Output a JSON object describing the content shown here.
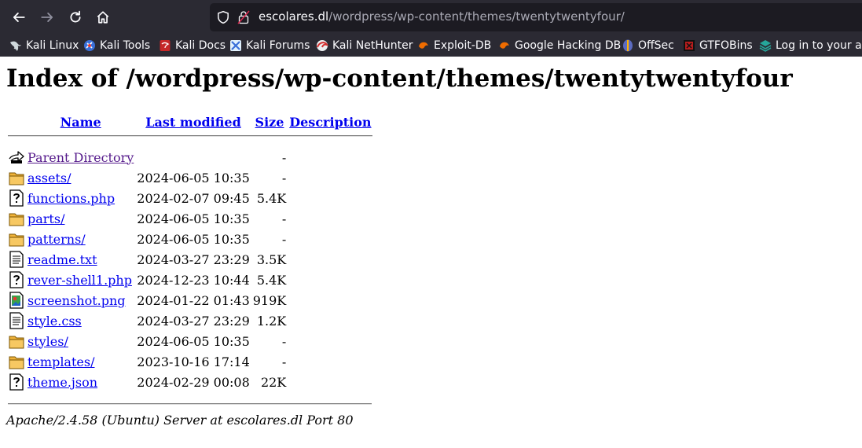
{
  "browser": {
    "url_host": "escolares.dl",
    "url_path": "/wordpress/wp-content/themes/twentytwentyfour/",
    "bookmarks": [
      {
        "label": "Kali Linux",
        "icon": "kali-dragon-icon",
        "color": "#cfd8dc"
      },
      {
        "label": "Kali Tools",
        "icon": "kali-tools-icon",
        "color": "#3a6fd8"
      },
      {
        "label": "Kali Docs",
        "icon": "kali-docs-icon",
        "color": "#c62828"
      },
      {
        "label": "Kali Forums",
        "icon": "kali-forums-icon",
        "color": "#3a6fd8"
      },
      {
        "label": "Kali NetHunter",
        "icon": "nethunter-icon",
        "color": "#d32f2f"
      },
      {
        "label": "Exploit-DB",
        "icon": "exploit-db-icon",
        "color": "#ef6c00"
      },
      {
        "label": "Google Hacking DB",
        "icon": "ghdb-icon",
        "color": "#ef6c00"
      },
      {
        "label": "OffSec",
        "icon": "offsec-icon",
        "color": "#5c6bc0"
      },
      {
        "label": "GTFOBins",
        "icon": "gtfobins-icon",
        "color": "#b71c1c"
      },
      {
        "label": "Log in to your acc",
        "icon": "login-icon",
        "color": "#26a69a"
      }
    ]
  },
  "page": {
    "title": "Index of /wordpress/wp-content/themes/twentytwentyfour",
    "columns": {
      "name": "Name",
      "modified": "Last modified",
      "size": "Size",
      "description": "Description"
    },
    "parent": {
      "name": "Parent Directory",
      "size": "-"
    },
    "rows": [
      {
        "icon": "folder-icon",
        "name": "assets/",
        "modified": "2024-06-05 10:35",
        "size": "-"
      },
      {
        "icon": "unknown-file-icon",
        "name": "functions.php",
        "modified": "2024-02-07 09:45",
        "size": "5.4K"
      },
      {
        "icon": "folder-icon",
        "name": "parts/",
        "modified": "2024-06-05 10:35",
        "size": "-"
      },
      {
        "icon": "folder-icon",
        "name": "patterns/",
        "modified": "2024-06-05 10:35",
        "size": "-"
      },
      {
        "icon": "text-file-icon",
        "name": "readme.txt",
        "modified": "2024-03-27 23:29",
        "size": "3.5K"
      },
      {
        "icon": "unknown-file-icon",
        "name": "rever-shell1.php",
        "modified": "2024-12-23 10:44",
        "size": "5.4K"
      },
      {
        "icon": "image-file-icon",
        "name": "screenshot.png",
        "modified": "2024-01-22 01:43",
        "size": "919K"
      },
      {
        "icon": "text-file-icon",
        "name": "style.css",
        "modified": "2024-03-27 23:29",
        "size": "1.2K"
      },
      {
        "icon": "folder-icon",
        "name": "styles/",
        "modified": "2024-06-05 10:35",
        "size": "-"
      },
      {
        "icon": "folder-icon",
        "name": "templates/",
        "modified": "2023-10-16 17:14",
        "size": "-"
      },
      {
        "icon": "unknown-file-icon",
        "name": "theme.json",
        "modified": "2024-02-29 00:08",
        "size": "22K"
      }
    ],
    "footer": "Apache/2.4.58 (Ubuntu) Server at escolares.dl Port 80"
  }
}
